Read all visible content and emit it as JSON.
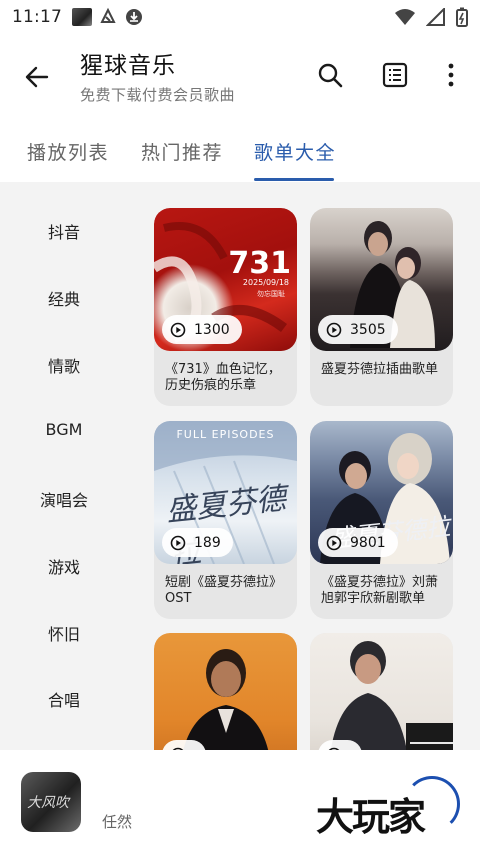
{
  "status_bar": {
    "time": "11:17"
  },
  "header": {
    "title": "猩球音乐",
    "subtitle": "免费下载付费会员歌曲"
  },
  "tabs": [
    {
      "label": "播放列表",
      "active": false
    },
    {
      "label": "热门推荐",
      "active": false
    },
    {
      "label": "歌单大全",
      "active": true
    }
  ],
  "sidebar": {
    "items": [
      {
        "label": "抖音"
      },
      {
        "label": "经典"
      },
      {
        "label": "情歌"
      },
      {
        "label": "BGM"
      },
      {
        "label": "演唱会"
      },
      {
        "label": "游戏"
      },
      {
        "label": "怀旧"
      },
      {
        "label": "合唱"
      }
    ]
  },
  "playlists": [
    {
      "plays": "1300",
      "title": "《731》血色记忆，历史伤痕的乐章",
      "cover": {
        "big": "731",
        "date": "2025/09/18",
        "note": "勿忘国耻"
      }
    },
    {
      "plays": "3505",
      "title": "盛夏芬德拉插曲歌单"
    },
    {
      "plays": "189",
      "title": "短剧《盛夏芬德拉》OST",
      "cover": {
        "label": "FULL EPISODES",
        "script": "盛夏芬德拉"
      }
    },
    {
      "plays": "9801",
      "title": "《盛夏芬德拉》刘萧旭郭宇欣新剧歌单",
      "cover": {
        "script": "盛夏芬德拉"
      }
    },
    {
      "plays": "",
      "title": ""
    },
    {
      "plays": "",
      "title": ""
    }
  ],
  "now_playing": {
    "album_text": "大风吹",
    "artist": "任然"
  },
  "watermark": {
    "text": "大玩家"
  },
  "colors": {
    "accent": "#2a5cac",
    "content_bg": "#f3f3f3",
    "card_bg": "#e6e6e6"
  }
}
